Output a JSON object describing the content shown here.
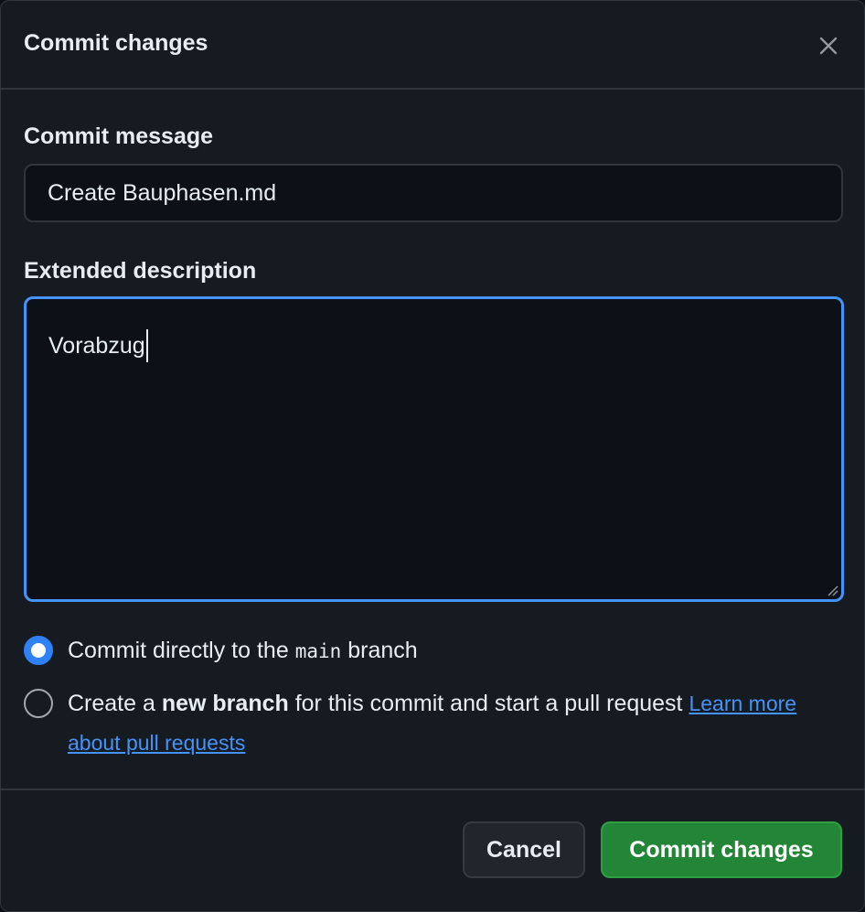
{
  "dialog": {
    "title": "Commit changes",
    "close_icon": "close-icon"
  },
  "form": {
    "message_label": "Commit message",
    "message_value": "Create Bauphasen.md",
    "description_label": "Extended description",
    "description_value": "Vorabzug"
  },
  "options": {
    "direct_prefix": "Commit directly to the ",
    "direct_branch": "main",
    "direct_suffix": " branch",
    "new_prefix": "Create a ",
    "new_bold": "new branch",
    "new_suffix": " for this commit and start a pull request ",
    "learn_more_link": "Learn more about pull requests",
    "selected": "direct"
  },
  "footer": {
    "cancel_label": "Cancel",
    "commit_label": "Commit changes"
  },
  "colors": {
    "accent": "#4493f8",
    "primary_button": "#238636",
    "background": "#161b22"
  }
}
